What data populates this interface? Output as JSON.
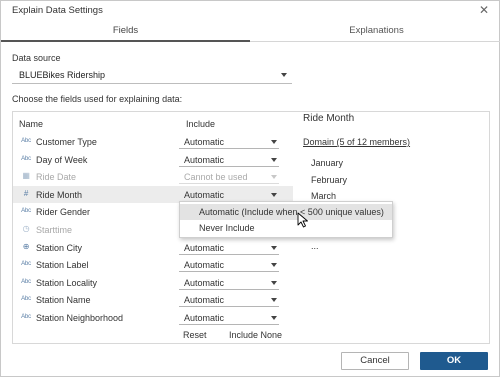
{
  "dialog": {
    "title": "Explain Data Settings",
    "close_glyph": "✕"
  },
  "tabs": [
    {
      "label": "Fields",
      "active": true
    },
    {
      "label": "Explanations",
      "active": false
    }
  ],
  "data_source": {
    "label": "Data source",
    "value": "BLUEBikes Ridership"
  },
  "instructions": "Choose the fields used for explaining data:",
  "table": {
    "header_name": "Name",
    "header_include": "Include",
    "rows": [
      {
        "icon_text": "Abc",
        "icon": "string-field-icon",
        "name": "Customer Type",
        "include": "Automatic",
        "disabled": false
      },
      {
        "icon_text": "Abc",
        "icon": "string-field-icon",
        "name": "Day of Week",
        "include": "Automatic",
        "disabled": false
      },
      {
        "icon_text": "▦",
        "icon": "date-field-icon",
        "name": "Ride Date",
        "include": "Cannot be used",
        "disabled": true
      },
      {
        "icon_text": "#",
        "icon": "bin-field-icon",
        "name": "Ride Month",
        "include": "Automatic",
        "disabled": false
      },
      {
        "icon_text": "Abc",
        "icon": "string-field-icon",
        "name": "Rider Gender",
        "include": "",
        "disabled": false
      },
      {
        "icon_text": "◷",
        "icon": "datetime-field-icon",
        "name": "Starttime",
        "include": "",
        "disabled": true
      },
      {
        "icon_text": "⊕",
        "icon": "geo-field-icon",
        "name": "Station City",
        "include": "Automatic",
        "disabled": false
      },
      {
        "icon_text": "Abc",
        "icon": "string-field-icon",
        "name": "Station Label",
        "include": "Automatic",
        "disabled": false
      },
      {
        "icon_text": "Abc",
        "icon": "string-field-icon",
        "name": "Station Locality",
        "include": "Automatic",
        "disabled": false
      },
      {
        "icon_text": "Abc",
        "icon": "string-field-icon",
        "name": "Station Name",
        "include": "Automatic",
        "disabled": false
      },
      {
        "icon_text": "Abc",
        "icon": "string-field-icon",
        "name": "Station Neighborhood",
        "include": "Automatic",
        "disabled": false
      }
    ],
    "reset_label": "Reset",
    "include_none_label": "Include None"
  },
  "dropdown": {
    "options": [
      "Automatic (Include when < 500 unique values)",
      "Never Include"
    ],
    "highlighted": "Automatic (Include when < 500 unique values)"
  },
  "detail": {
    "title": "Ride Month",
    "domain_link": "Domain (5 of 12 members)",
    "members": [
      "January",
      "February",
      "March",
      "",
      "",
      "..."
    ]
  },
  "buttons": {
    "cancel": "Cancel",
    "ok": "OK"
  },
  "colors": {
    "ok_button": "#1f5a8f",
    "field_icon": "#5b7fa6",
    "disabled_text": "#a8a8a8"
  }
}
